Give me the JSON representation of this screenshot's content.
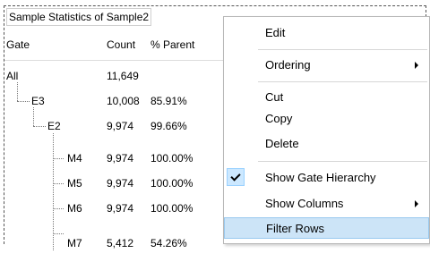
{
  "panel": {
    "title": "Sample Statistics of Sample2",
    "columns": {
      "gate": "Gate",
      "count": "Count",
      "parent": "% Parent"
    },
    "rows": [
      {
        "gate": "All",
        "count": "11,649",
        "parent": ""
      },
      {
        "gate": "E3",
        "count": "10,008",
        "parent": "85.91%"
      },
      {
        "gate": "E2",
        "count": "9,974",
        "parent": "99.66%"
      },
      {
        "gate": "M4",
        "count": "9,974",
        "parent": "100.00%"
      },
      {
        "gate": "M5",
        "count": "9,974",
        "parent": "100.00%"
      },
      {
        "gate": "M6",
        "count": "9,974",
        "parent": "100.00%"
      },
      {
        "gate": "M7",
        "count": "5,412",
        "parent": "54.26%"
      }
    ]
  },
  "context_menu": {
    "items": [
      {
        "label": "Edit"
      },
      {
        "label": "Ordering",
        "submenu": true
      },
      {
        "label": "Cut"
      },
      {
        "label": "Copy"
      },
      {
        "label": "Delete"
      },
      {
        "label": "Show Gate Hierarchy",
        "checked": true
      },
      {
        "label": "Show Columns",
        "submenu": true
      },
      {
        "label": "Filter Rows",
        "highlighted": true
      }
    ]
  },
  "colors": {
    "highlight": "#cce4f7",
    "highlight_border": "#99c9ef",
    "check_background": "#cce8ff"
  }
}
